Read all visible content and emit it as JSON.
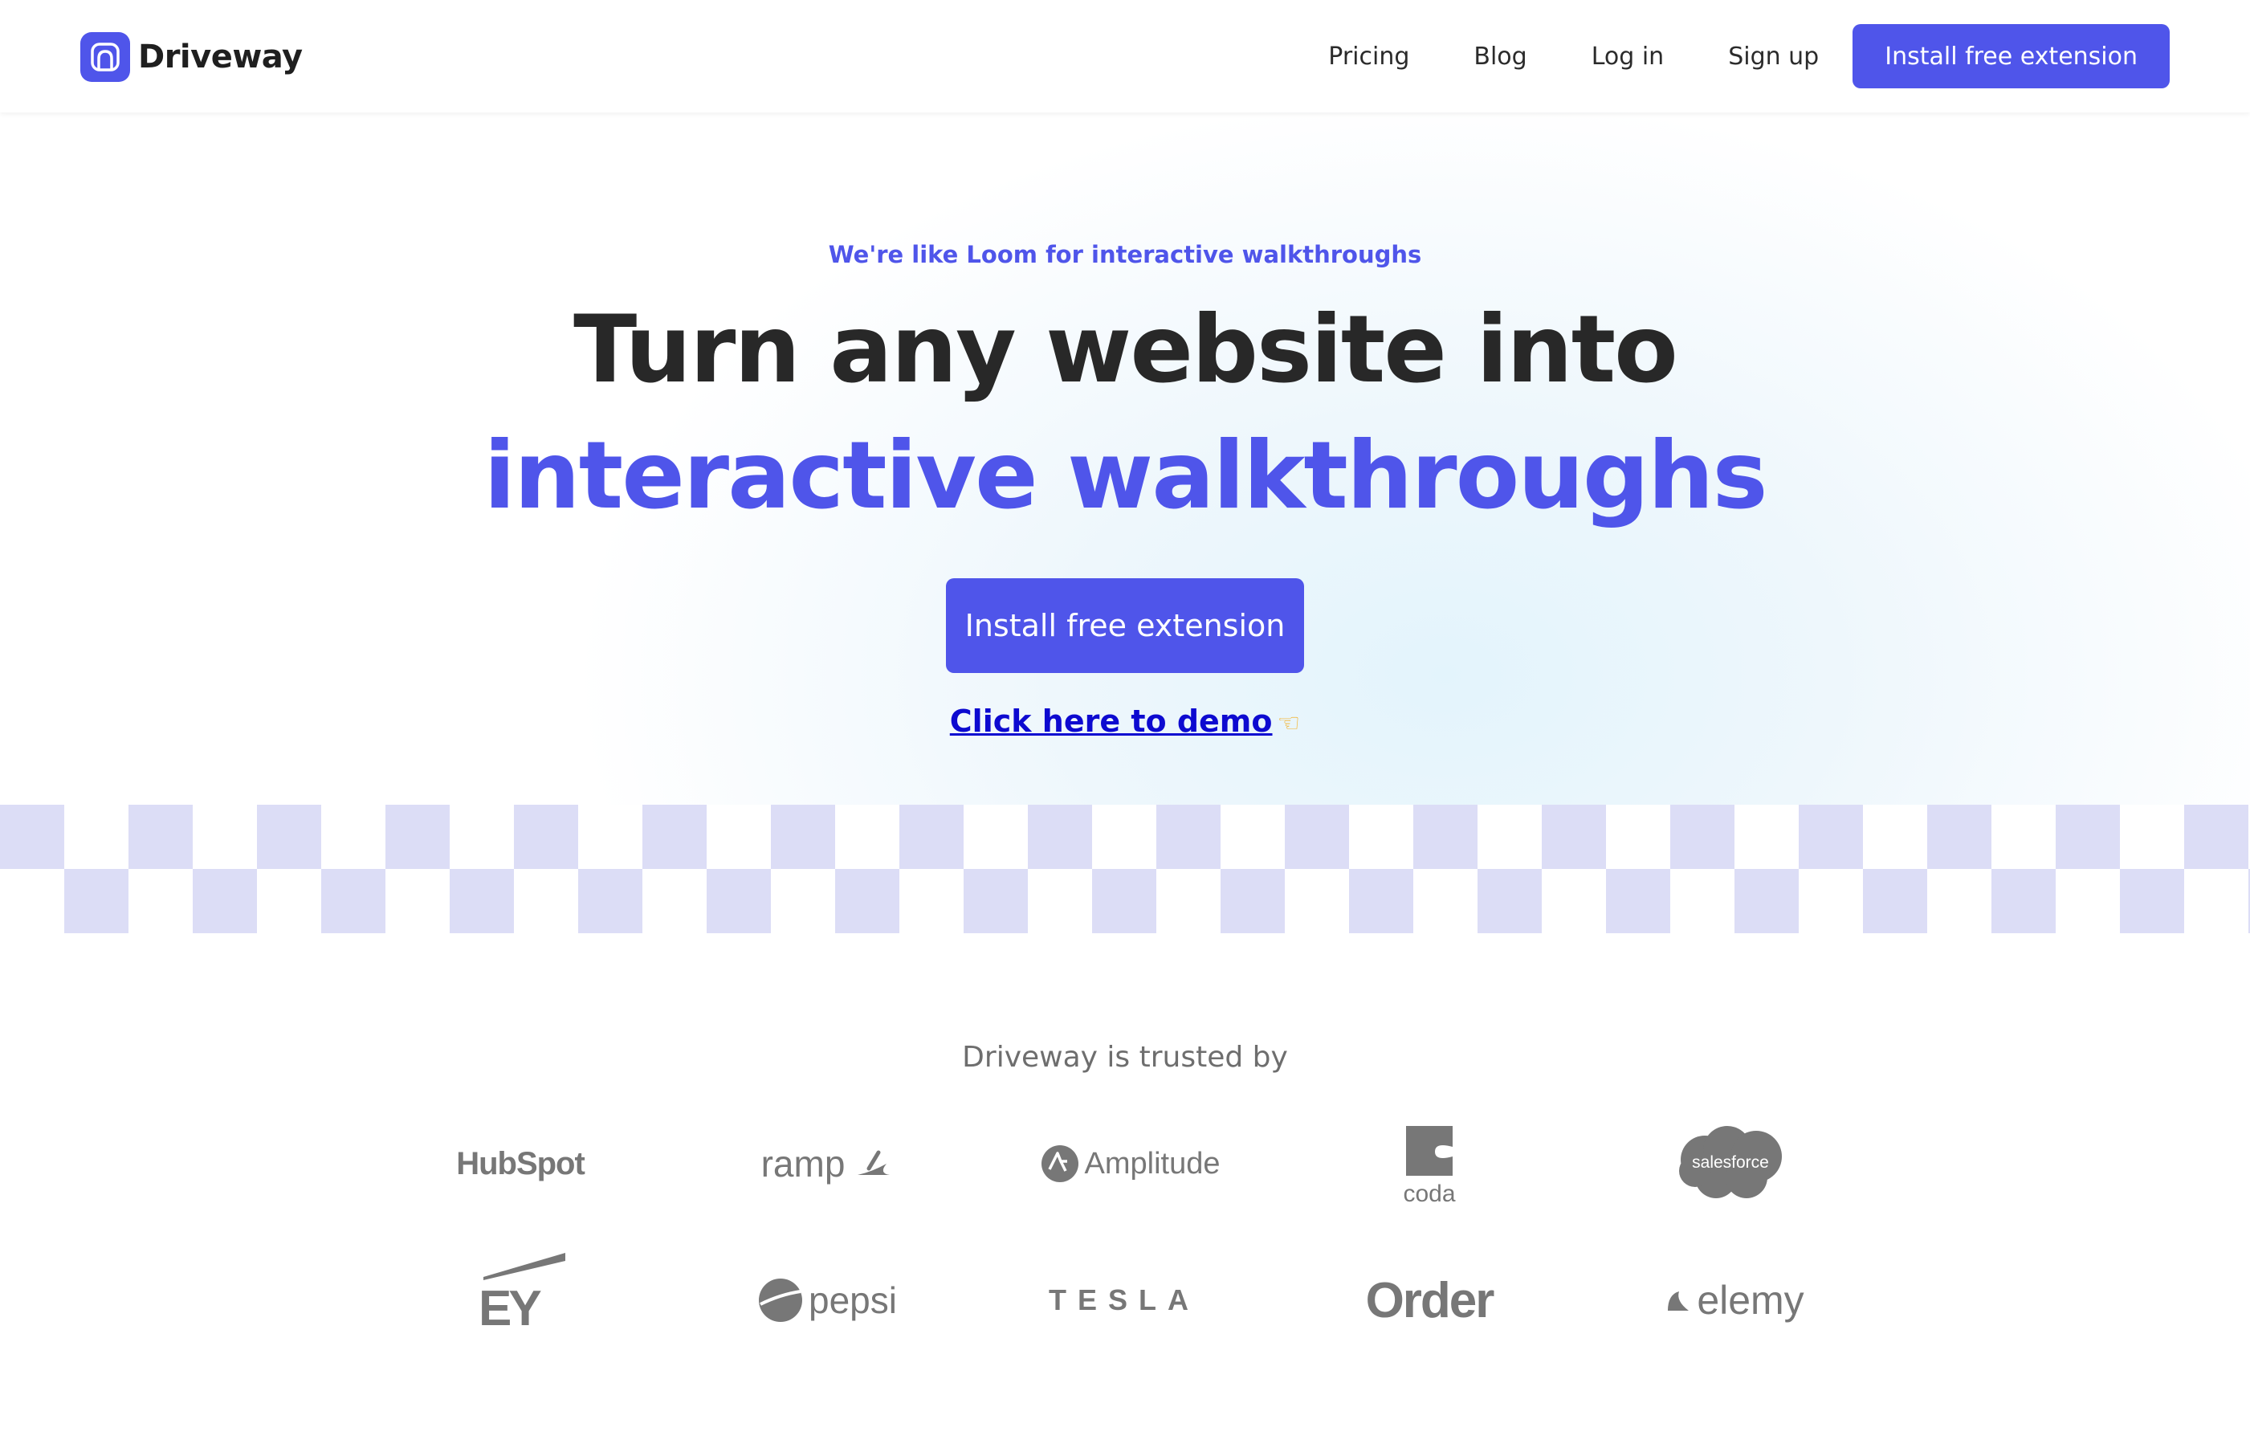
{
  "header": {
    "logo_text": "Driveway",
    "nav": {
      "pricing": "Pricing",
      "blog": "Blog",
      "login": "Log in",
      "signup": "Sign up",
      "cta": "Install free extension"
    }
  },
  "hero": {
    "tagline": "We're like Loom for interactive walkthroughs",
    "headline_line1": "Turn any website into",
    "headline_line2": "interactive walkthroughs",
    "cta": "Install free extension",
    "demo_link": "Click here to demo"
  },
  "trusted": {
    "title": "Driveway is trusted by",
    "logos": {
      "hubspot": "HubSpot",
      "ramp": "ramp",
      "amplitude": "Amplitude",
      "coda": "coda",
      "salesforce": "salesforce",
      "ey": "EY",
      "pepsi": "pepsi",
      "tesla": "TESLA",
      "order": "Order",
      "elemy": "elemy"
    }
  },
  "colors": {
    "accent": "#4f55ea",
    "heading": "#282828",
    "link": "#0d0ad0",
    "checker": "#dcddf6",
    "logo_gray": "#777777"
  },
  "icons": [
    "driveway-logo-icon",
    "pointing-hand-icon",
    "ramp-icon",
    "amplitude-icon",
    "coda-icon",
    "salesforce-cloud-icon",
    "ey-beam-icon",
    "pepsi-globe-icon",
    "elemy-leaf-icon"
  ]
}
